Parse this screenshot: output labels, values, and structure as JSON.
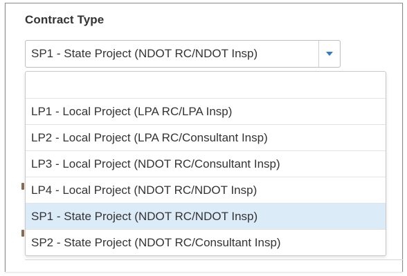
{
  "field": {
    "label": "Contract Type",
    "selected_value": "SP1 - State Project (NDOT RC/NDOT Insp)",
    "dropdown_button_icon": "chevron-down-icon",
    "accent_color": "#2f7bd1"
  },
  "dropdown": {
    "items": [
      {
        "label": "",
        "selected": false
      },
      {
        "label": "LP1 - Local Project (LPA RC/LPA Insp)",
        "selected": false
      },
      {
        "label": "LP2 - Local Project (LPA RC/Consultant Insp)",
        "selected": false
      },
      {
        "label": "LP3 - Local Project (NDOT RC/Consultant Insp)",
        "selected": false
      },
      {
        "label": "LP4 - Local Project (NDOT RC/NDOT Insp)",
        "selected": false
      },
      {
        "label": "SP1 - State Project (NDOT RC/NDOT Insp)",
        "selected": true
      },
      {
        "label": "SP2 - State Project (NDOT RC/Consultant Insp)",
        "selected": false
      }
    ],
    "highlight_color": "#dcebf8"
  }
}
